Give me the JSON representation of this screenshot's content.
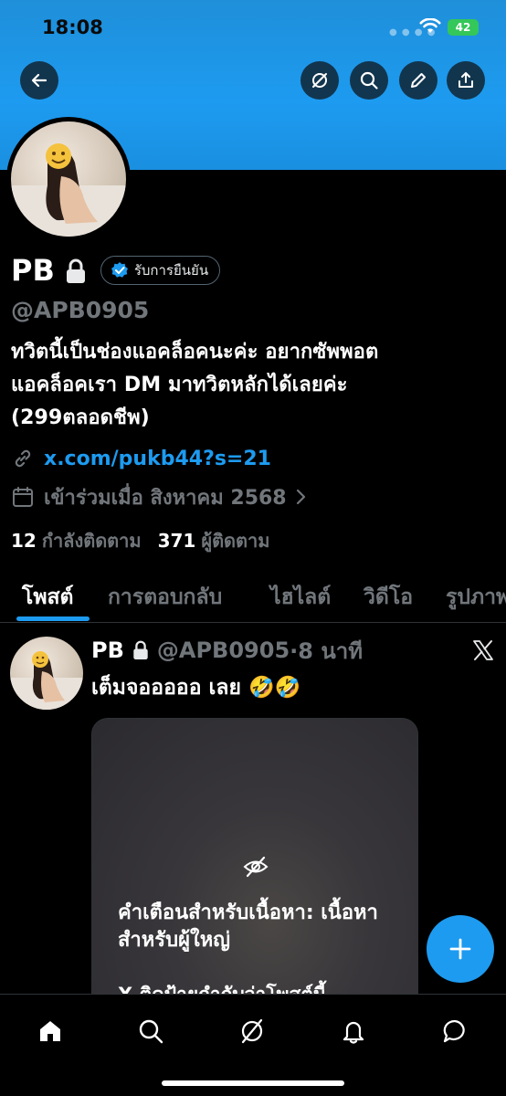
{
  "status_bar": {
    "time": "18:08",
    "battery": "42"
  },
  "header": {
    "back_icon": "arrow-left-icon",
    "actions": [
      "hide-icon",
      "search-icon",
      "edit-icon",
      "share-icon"
    ]
  },
  "profile": {
    "name": "PB",
    "verify_label": "รับการยืนยัน",
    "handle": "@APB0905",
    "bio_lines": [
      "ทวิตนี้เป็นช่องแอคล็อคนะค่ะ อยากซัพพอต",
      "แอคล็อคเรา DM มาทวิตหลักได้เลยค่ะ",
      "(299ตลอดชีพ)"
    ],
    "link": "x.com/pukb44?s=21",
    "joined": "เข้าร่วมเมื่อ สิงหาคม 2568",
    "following_count": "12",
    "following_label": "กำลังติดตาม",
    "followers_count": "371",
    "followers_label": "ผู้ติดตาม"
  },
  "tabs": [
    "โพสต์",
    "การตอบกลับ",
    "ไฮไลต์",
    "วิดีโอ",
    "รูปภาพ"
  ],
  "active_tab": "โพสต์",
  "post": {
    "name": "PB",
    "handle": "@APB0905",
    "time": "·8 นาที",
    "text": "เต็มจอออออ เลย 🤣🤣",
    "warning_title": "คำเตือนสำหรับเนื้อหา: เนื้อหาสำหรับผู้ใหญ่",
    "warning_sub": "X ติดป้ายกำกับว่าโพสต์นี้"
  },
  "bottom_nav": [
    "home-icon",
    "search-icon",
    "grok-icon",
    "notifications-icon",
    "messages-icon"
  ],
  "colors": {
    "accent": "#1d9bf0",
    "background": "#000000",
    "muted": "#71767b"
  }
}
